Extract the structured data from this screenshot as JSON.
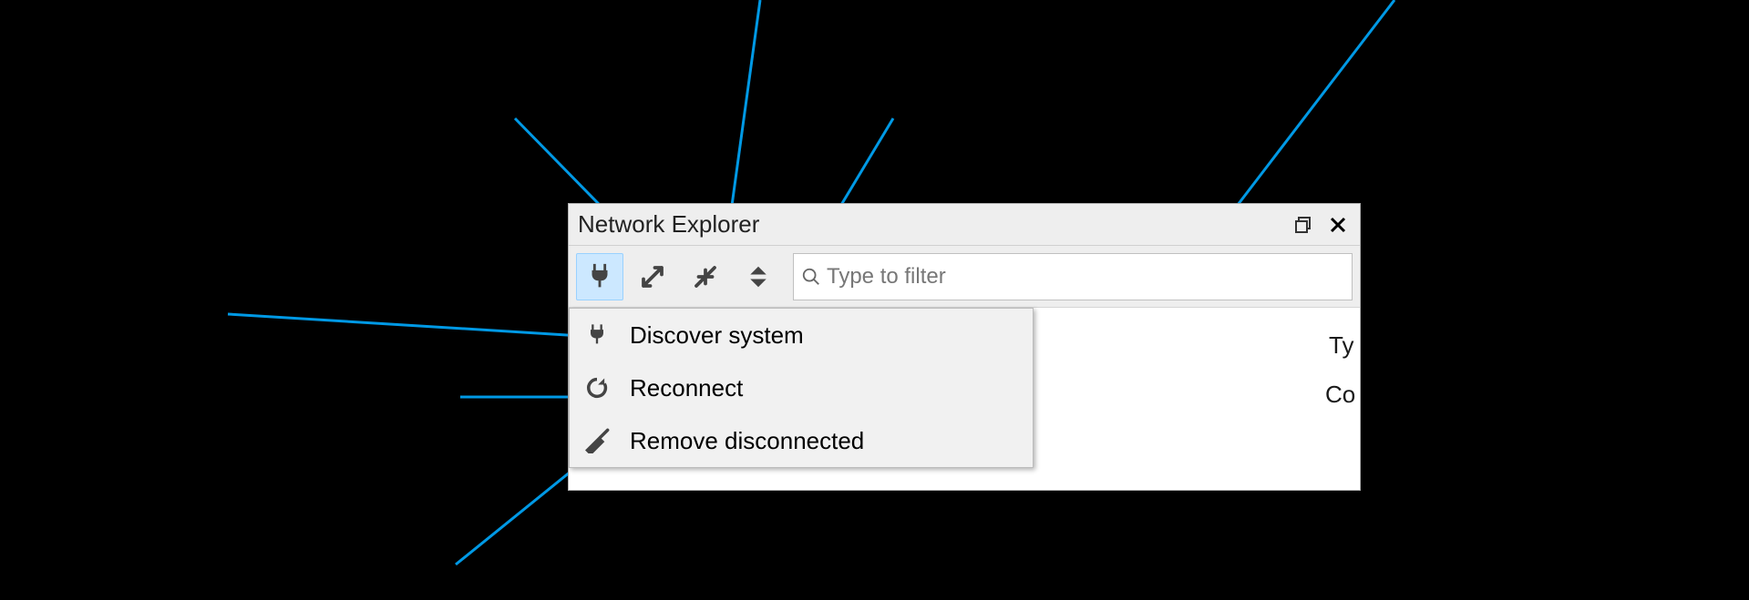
{
  "panel": {
    "title": "Network Explorer"
  },
  "toolbar": {
    "buttons": [
      {
        "name": "plug",
        "active": true
      },
      {
        "name": "expand"
      },
      {
        "name": "collapse"
      },
      {
        "name": "sort"
      }
    ]
  },
  "search": {
    "placeholder": "Type to filter"
  },
  "dropdown": {
    "items": [
      {
        "icon": "plug-icon",
        "label": "Discover system"
      },
      {
        "icon": "refresh-icon",
        "label": "Reconnect"
      },
      {
        "icon": "broom-icon",
        "label": "Remove disconnected"
      }
    ]
  },
  "columns": {
    "col1_head": "Ty",
    "col1_cell": "Co"
  }
}
